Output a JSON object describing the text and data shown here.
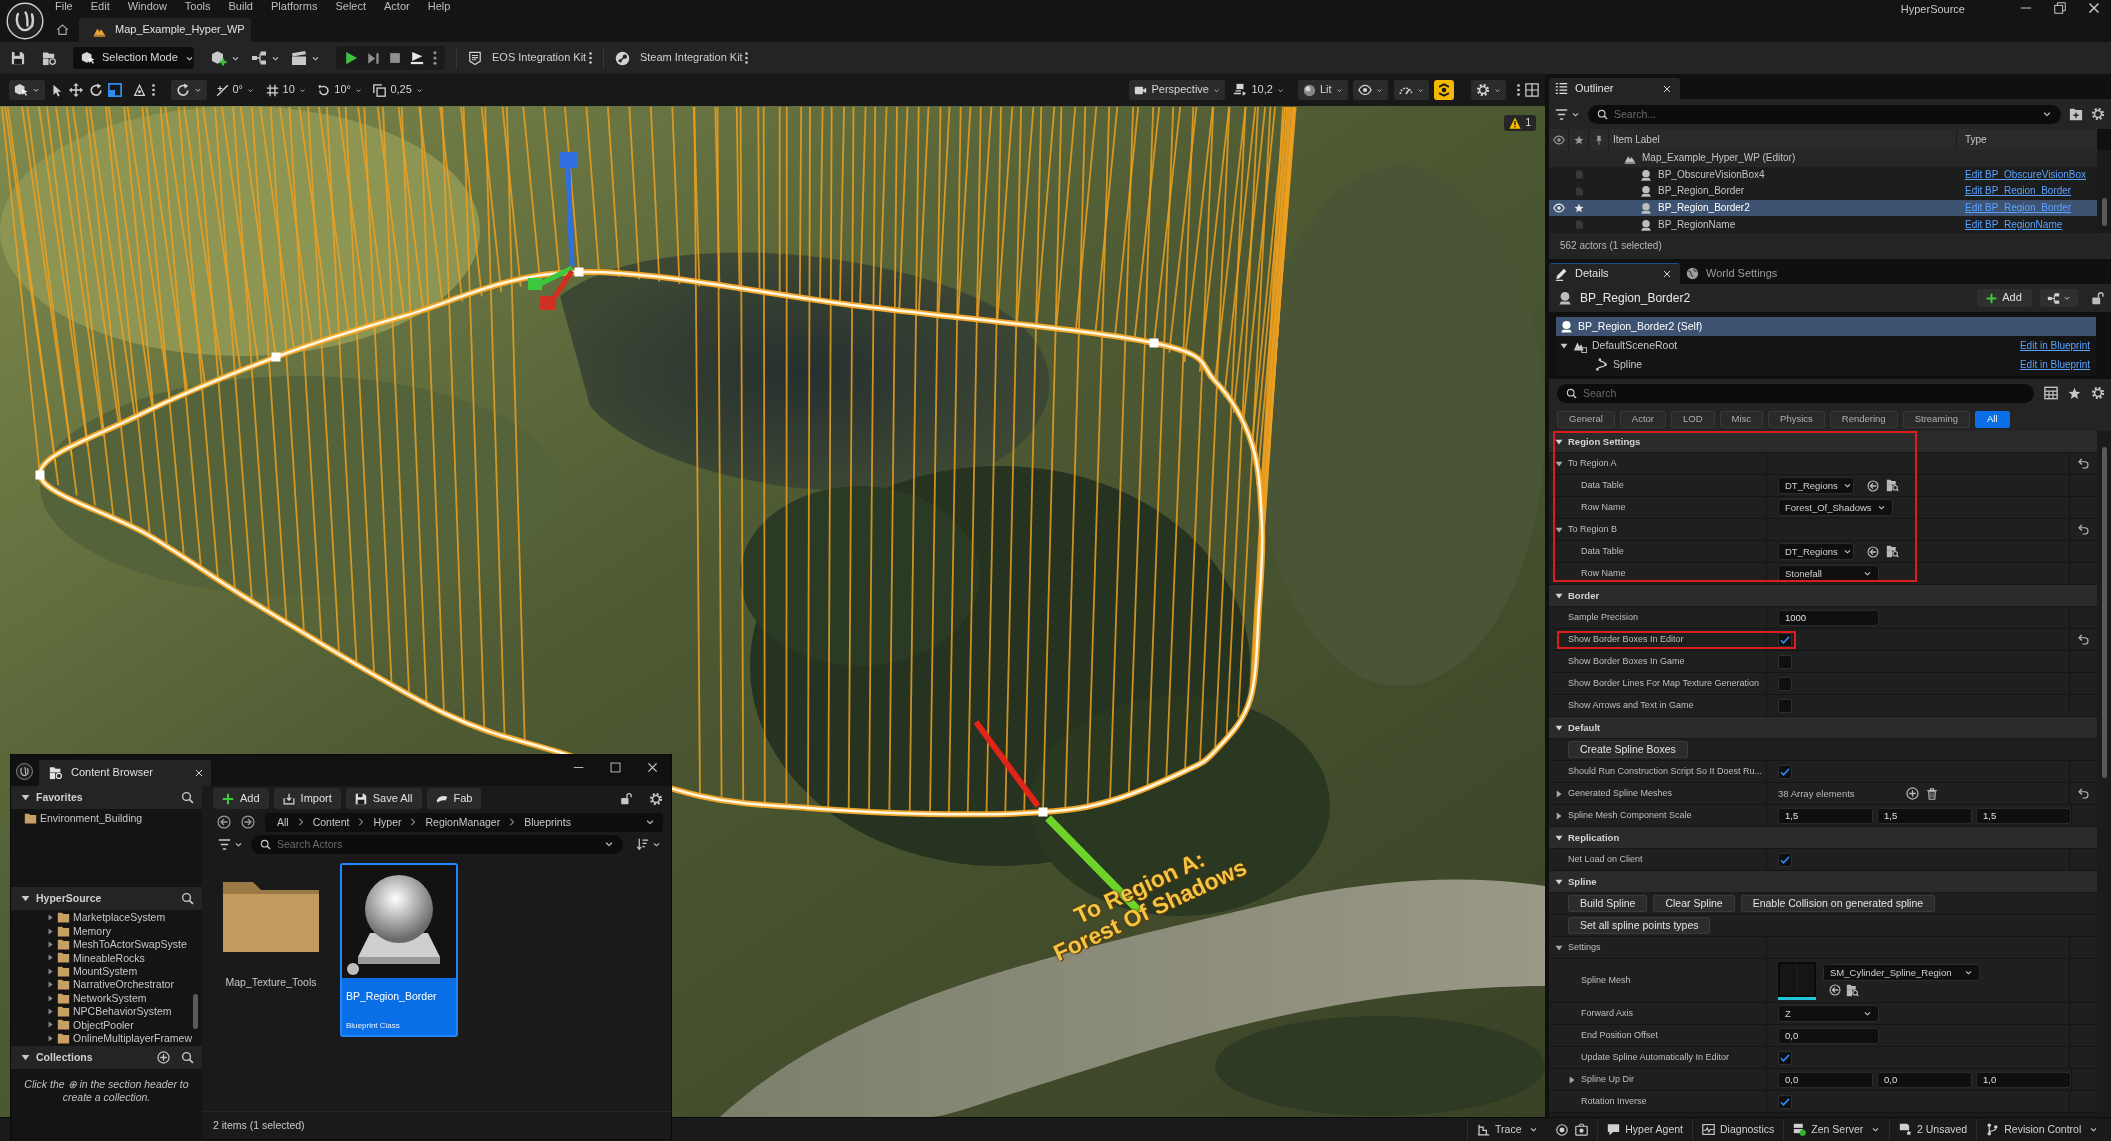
{
  "app": {
    "title": "HyperSource",
    "menu": [
      "File",
      "Edit",
      "Window",
      "Tools",
      "Build",
      "Platforms",
      "Select",
      "Actor",
      "Help"
    ]
  },
  "document_tabs": [
    {
      "label": "Map_Example_Hyper_WP",
      "selected": true
    }
  ],
  "toolbar": {
    "mode": "Selection Mode",
    "plugins": [
      {
        "kind": "epic",
        "label": "EOS Integration Kit"
      },
      {
        "kind": "steam",
        "label": "Steam Integration Kit"
      }
    ]
  },
  "viewport": {
    "snaps": [
      {
        "kind": "surface",
        "value": "0°"
      },
      {
        "kind": "grid",
        "value": "10"
      },
      {
        "kind": "rotation",
        "value": "10°"
      },
      {
        "kind": "scale",
        "value": "0,25"
      }
    ],
    "view": "Perspective",
    "camera_speed": "10,2",
    "view_mode": "Lit",
    "toolbar_toggle": {
      "on": true
    },
    "warnings": "1",
    "labels": [
      {
        "lines": [
          "To Region A:",
          "Forest Of Shadows"
        ]
      }
    ]
  },
  "outliner": {
    "tab": "Outliner",
    "search_placeholder": "Search...",
    "columns": [
      "Item Label",
      "Type"
    ],
    "rows": [
      {
        "label": "Map_Example_Hyper_WP (Editor)",
        "kind": "world",
        "selected": false,
        "children": [
          {
            "label": "BP_ObscureVisionBox4",
            "kind": "actor",
            "type": "Edit BP_ObscureVisionBox",
            "selected": false
          },
          {
            "label": "BP_Region_Border",
            "kind": "actor",
            "type": "Edit BP_Region_Border",
            "selected": false
          },
          {
            "label": "BP_Region_Border2",
            "kind": "actor",
            "type": "Edit BP_Region_Border",
            "selected": true
          },
          {
            "label": "BP_RegionName",
            "kind": "actor",
            "type": "Edit BP_RegionName",
            "selected": false
          }
        ]
      }
    ],
    "status": "562 actors (1 selected)"
  },
  "details": {
    "tabs": [
      {
        "label": "Details",
        "kind": "details",
        "selected": true
      },
      {
        "label": "World Settings",
        "kind": "world",
        "selected": false
      }
    ],
    "actor": "BP_Region_Border2",
    "add": "Add",
    "components": [
      {
        "label": "BP_Region_Border2 (Self)",
        "kind": "self",
        "selected": true
      },
      {
        "label": "DefaultSceneRoot",
        "kind": "scene",
        "selected": false,
        "expanded": true,
        "link": "Edit in Blueprint",
        "children": [
          {
            "label": "Spline",
            "kind": "spline",
            "selected": false,
            "link": "Edit in Blueprint"
          }
        ]
      }
    ],
    "search_placeholder": "Search",
    "categories": [
      {
        "label": "General",
        "selected": false
      },
      {
        "label": "Actor",
        "selected": false
      },
      {
        "label": "LOD",
        "selected": false
      },
      {
        "label": "Misc",
        "selected": false
      },
      {
        "label": "Physics",
        "selected": false
      },
      {
        "label": "Rendering",
        "selected": false
      },
      {
        "label": "Streaming",
        "selected": false
      },
      {
        "label": "All",
        "selected": true
      }
    ],
    "sections": [
      {
        "title": "Region Settings",
        "expanded": true,
        "highlighted": true,
        "rows": [
          {
            "kind": "group",
            "label": "To Region A",
            "expanded": true,
            "resettable": true,
            "children": [
              {
                "kind": "asset",
                "label": "Data Table",
                "value": "DT_Regions",
                "resettable": false
              },
              {
                "kind": "combo",
                "label": "Row Name",
                "value": "Forest_Of_Shadows",
                "resettable": false
              }
            ]
          },
          {
            "kind": "group",
            "label": "To Region B",
            "expanded": true,
            "resettable": true,
            "children": [
              {
                "kind": "asset",
                "label": "Data Table",
                "value": "DT_Regions",
                "resettable": false
              },
              {
                "kind": "combo",
                "label": "Row Name",
                "value": "Stonefall",
                "resettable": false
              }
            ]
          }
        ]
      },
      {
        "title": "Border",
        "expanded": true,
        "highlighted": false,
        "rows": [
          {
            "kind": "number",
            "label": "Sample Precision",
            "value": "1000",
            "resettable": false
          },
          {
            "kind": "check",
            "label": "Show Border Boxes In Editor",
            "checked": true,
            "highlighted": true,
            "resettable": true
          },
          {
            "kind": "check",
            "label": "Show Border Boxes In Game",
            "checked": false,
            "highlighted": false,
            "resettable": false
          },
          {
            "kind": "check",
            "label": "Show Border Lines For Map Texture Generation",
            "checked": false,
            "highlighted": false,
            "resettable": false
          },
          {
            "kind": "check",
            "label": "Show Arrows and Text in Game",
            "checked": false,
            "highlighted": false,
            "resettable": false
          }
        ]
      },
      {
        "title": "Default",
        "expanded": true,
        "highlighted": false,
        "rows": [
          {
            "kind": "buttons",
            "buttons": [
              "Create Spline Boxes"
            ]
          },
          {
            "kind": "check",
            "label": "Should Run Construction Script So It Doest Ru...",
            "checked": true,
            "highlighted": false,
            "resettable": false
          },
          {
            "kind": "array",
            "label": "Generated Spline Meshes",
            "value": "38 Array elements",
            "expanded": false,
            "resettable": true
          },
          {
            "kind": "vector",
            "label": "Spline Mesh Component Scale",
            "values": [
              "1,5",
              "1,5",
              "1,5"
            ],
            "expanded": false,
            "resettable": false
          }
        ]
      },
      {
        "title": "Replication",
        "expanded": true,
        "highlighted": false,
        "rows": [
          {
            "kind": "check",
            "label": "Net Load on Client",
            "checked": true,
            "highlighted": false,
            "resettable": false
          }
        ]
      },
      {
        "title": "Spline",
        "expanded": true,
        "highlighted": false,
        "rows": [
          {
            "kind": "buttons",
            "buttons": [
              "Build Spline",
              "Clear Spline",
              "Enable Collision on generated spline"
            ]
          },
          {
            "kind": "buttons",
            "buttons": [
              "Set all spline points types"
            ]
          },
          {
            "kind": "group",
            "label": "Settings",
            "expanded": true,
            "resettable": false,
            "children": [
              {
                "kind": "mesh",
                "label": "Spline Mesh",
                "value": "SM_Cylinder_Spline_Region",
                "resettable": false
              },
              {
                "kind": "combo",
                "label": "Forward Axis",
                "value": "Z",
                "resettable": false
              },
              {
                "kind": "number",
                "label": "End Position Offset",
                "value": "0,0",
                "resettable": false
              },
              {
                "kind": "check",
                "label": "Update Spline Automatically In Editor",
                "checked": true,
                "highlighted": false,
                "resettable": false
              },
              {
                "kind": "vector",
                "label": "Spline Up Dir",
                "values": [
                  "0,0",
                  "0,0",
                  "1,0"
                ],
                "expanded": false,
                "resettable": false
              },
              {
                "kind": "check",
                "label": "Rotation Inverse",
                "checked": true,
                "highlighted": false,
                "resettable": false
              }
            ]
          }
        ]
      }
    ]
  },
  "content_browser": {
    "title": "Content Browser",
    "favorites": {
      "title": "Favorites",
      "expanded": true,
      "items": [
        "Environment_Building"
      ]
    },
    "source": {
      "title": "HyperSource",
      "expanded": true,
      "items": [
        "MarketplaceSystem",
        "Memory",
        "MeshToActorSwapSyste",
        "MineableRocks",
        "MountSystem",
        "NarrativeOrchestrator",
        "NetworkSystem",
        "NPCBehaviorSystem",
        "ObjectPooler",
        "OnlineMultiplayerFramew"
      ]
    },
    "collections": {
      "title": "Collections",
      "expanded": true,
      "hint": "Click the ⊕ in the section header to create a collection."
    },
    "actions": [
      {
        "kind": "add",
        "label": "Add"
      },
      {
        "kind": "import",
        "label": "Import"
      },
      {
        "kind": "save",
        "label": "Save All"
      },
      {
        "kind": "fab",
        "label": "Fab"
      }
    ],
    "path": [
      "All",
      "Content",
      "Hyper",
      "RegionManager",
      "Blueprints"
    ],
    "search_placeholder": "Search Actors",
    "assets": [
      {
        "kind": "folder",
        "label": "Map_Texture_Tools",
        "selected": false
      },
      {
        "kind": "blueprint",
        "label": "BP_Region_Border",
        "type": "Blueprint Class",
        "selected": true
      }
    ],
    "status": "2 items (1 selected)"
  },
  "status_bar": [
    {
      "kind": "trace",
      "label": "Trace",
      "menu": true
    },
    {
      "kind": "agent",
      "label": "Hyper Agent",
      "menu": false
    },
    {
      "kind": "diagnostics",
      "label": "Diagnostics",
      "menu": false
    },
    {
      "kind": "server",
      "label": "Zen Server",
      "menu": true
    },
    {
      "kind": "unsaved",
      "label": "2 Unsaved",
      "menu": false
    },
    {
      "kind": "revision",
      "label": "Revision Control",
      "menu": true
    }
  ]
}
